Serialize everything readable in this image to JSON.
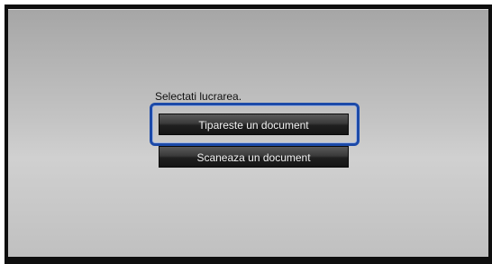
{
  "screen": {
    "prompt": "Selectati lucrarea.",
    "selected_index": 0,
    "options": [
      {
        "label": "Tipareste un document"
      },
      {
        "label": "Scaneaza un document"
      }
    ]
  },
  "colors": {
    "selection_border": "#1c4aa8",
    "button_bg": "#202020",
    "button_text": "#f2f2f2",
    "screen_bg": "#c4c4c4"
  }
}
